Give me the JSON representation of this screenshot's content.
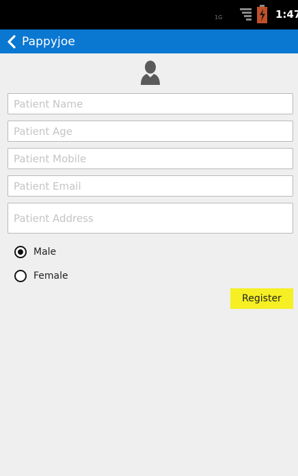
{
  "status_bar": {
    "network_type": "1G",
    "time": "1:47"
  },
  "action_bar": {
    "title": "Pappyjoe",
    "back_icon": "chevron-left-icon"
  },
  "form": {
    "avatar_icon": "person-icon",
    "patient_name": {
      "placeholder": "Patient Name",
      "value": ""
    },
    "patient_age": {
      "placeholder": "Patient Age",
      "value": ""
    },
    "patient_mobile": {
      "placeholder": "Patient Mobile",
      "value": ""
    },
    "patient_email": {
      "placeholder": "Patient Email",
      "value": ""
    },
    "patient_address": {
      "placeholder": "Patient Address",
      "value": ""
    },
    "gender": {
      "options": [
        "Male",
        "Female"
      ],
      "selected": "Male"
    },
    "register_label": "Register"
  },
  "colors": {
    "action_bar": "#0a77d1",
    "register_button": "#f5ef23",
    "background": "#efefef",
    "battery": "#c0502a"
  }
}
